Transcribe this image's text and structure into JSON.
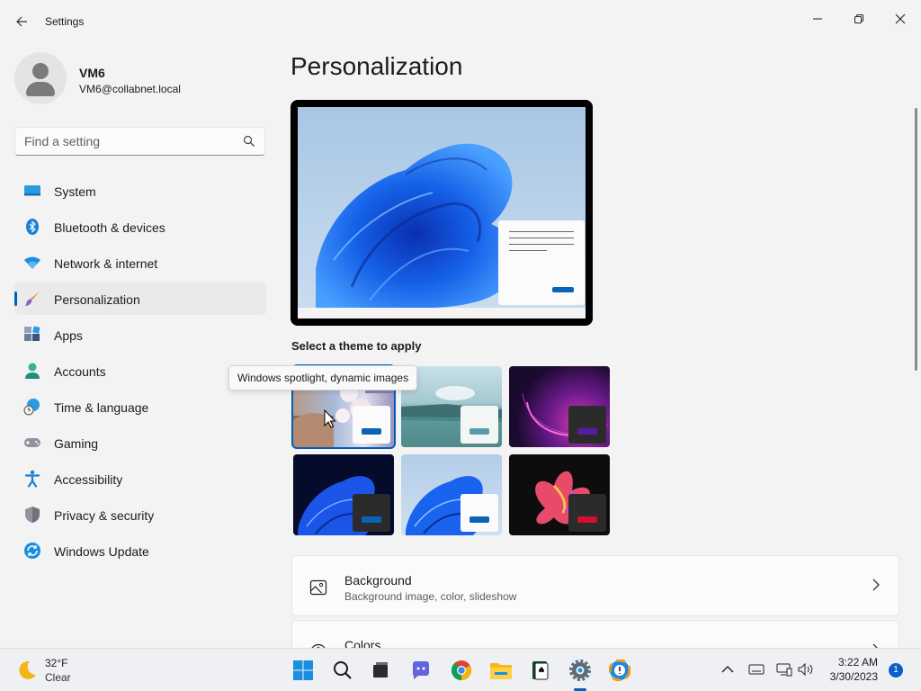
{
  "window": {
    "title": "Settings",
    "controls": [
      "minimize",
      "maximize",
      "close"
    ]
  },
  "profile": {
    "name": "VM6",
    "email": "VM6@collabnet.local"
  },
  "search": {
    "placeholder": "Find a setting"
  },
  "sidebar": {
    "items": [
      {
        "label": "System",
        "icon": "system-icon"
      },
      {
        "label": "Bluetooth & devices",
        "icon": "bluetooth-icon"
      },
      {
        "label": "Network & internet",
        "icon": "wifi-icon"
      },
      {
        "label": "Personalization",
        "icon": "brush-icon",
        "active": true
      },
      {
        "label": "Apps",
        "icon": "apps-icon"
      },
      {
        "label": "Accounts",
        "icon": "accounts-icon"
      },
      {
        "label": "Time & language",
        "icon": "globe-clock-icon"
      },
      {
        "label": "Gaming",
        "icon": "gamepad-icon"
      },
      {
        "label": "Accessibility",
        "icon": "accessibility-icon"
      },
      {
        "label": "Privacy & security",
        "icon": "shield-icon"
      },
      {
        "label": "Windows Update",
        "icon": "update-icon"
      }
    ]
  },
  "main": {
    "title": "Personalization",
    "theme_heading": "Select a theme to apply",
    "tooltip": "Windows spotlight, dynamic images",
    "themes": [
      {
        "name": "windows-spotlight",
        "accent": "#0a63b8",
        "selected": true
      },
      {
        "name": "glow-lake",
        "accent": "#5b9cac"
      },
      {
        "name": "captured-motion-dark",
        "accent": "#5a1aa8"
      },
      {
        "name": "windows-dark",
        "accent": "#0a63b8"
      },
      {
        "name": "windows-light",
        "accent": "#0a63b8"
      },
      {
        "name": "flow-dark",
        "accent": "#d3102d"
      }
    ],
    "cards": [
      {
        "title": "Background",
        "subtitle": "Background image, color, slideshow",
        "icon": "image-icon"
      },
      {
        "title": "Colors",
        "subtitle": "",
        "icon": "palette-icon"
      }
    ]
  },
  "taskbar": {
    "weather": {
      "temp": "32°F",
      "condition": "Clear"
    },
    "apps": [
      "start-icon",
      "search-icon",
      "file-explorer-preview-icon",
      "teams-chat-icon",
      "chrome-icon",
      "file-explorer-icon",
      "solitaire-icon",
      "settings-icon",
      "other-app-icon"
    ],
    "clock": {
      "time": "3:22 AM",
      "date": "3/30/2023"
    },
    "notifications": "1"
  },
  "colors": {
    "accent": "#005fb8"
  }
}
